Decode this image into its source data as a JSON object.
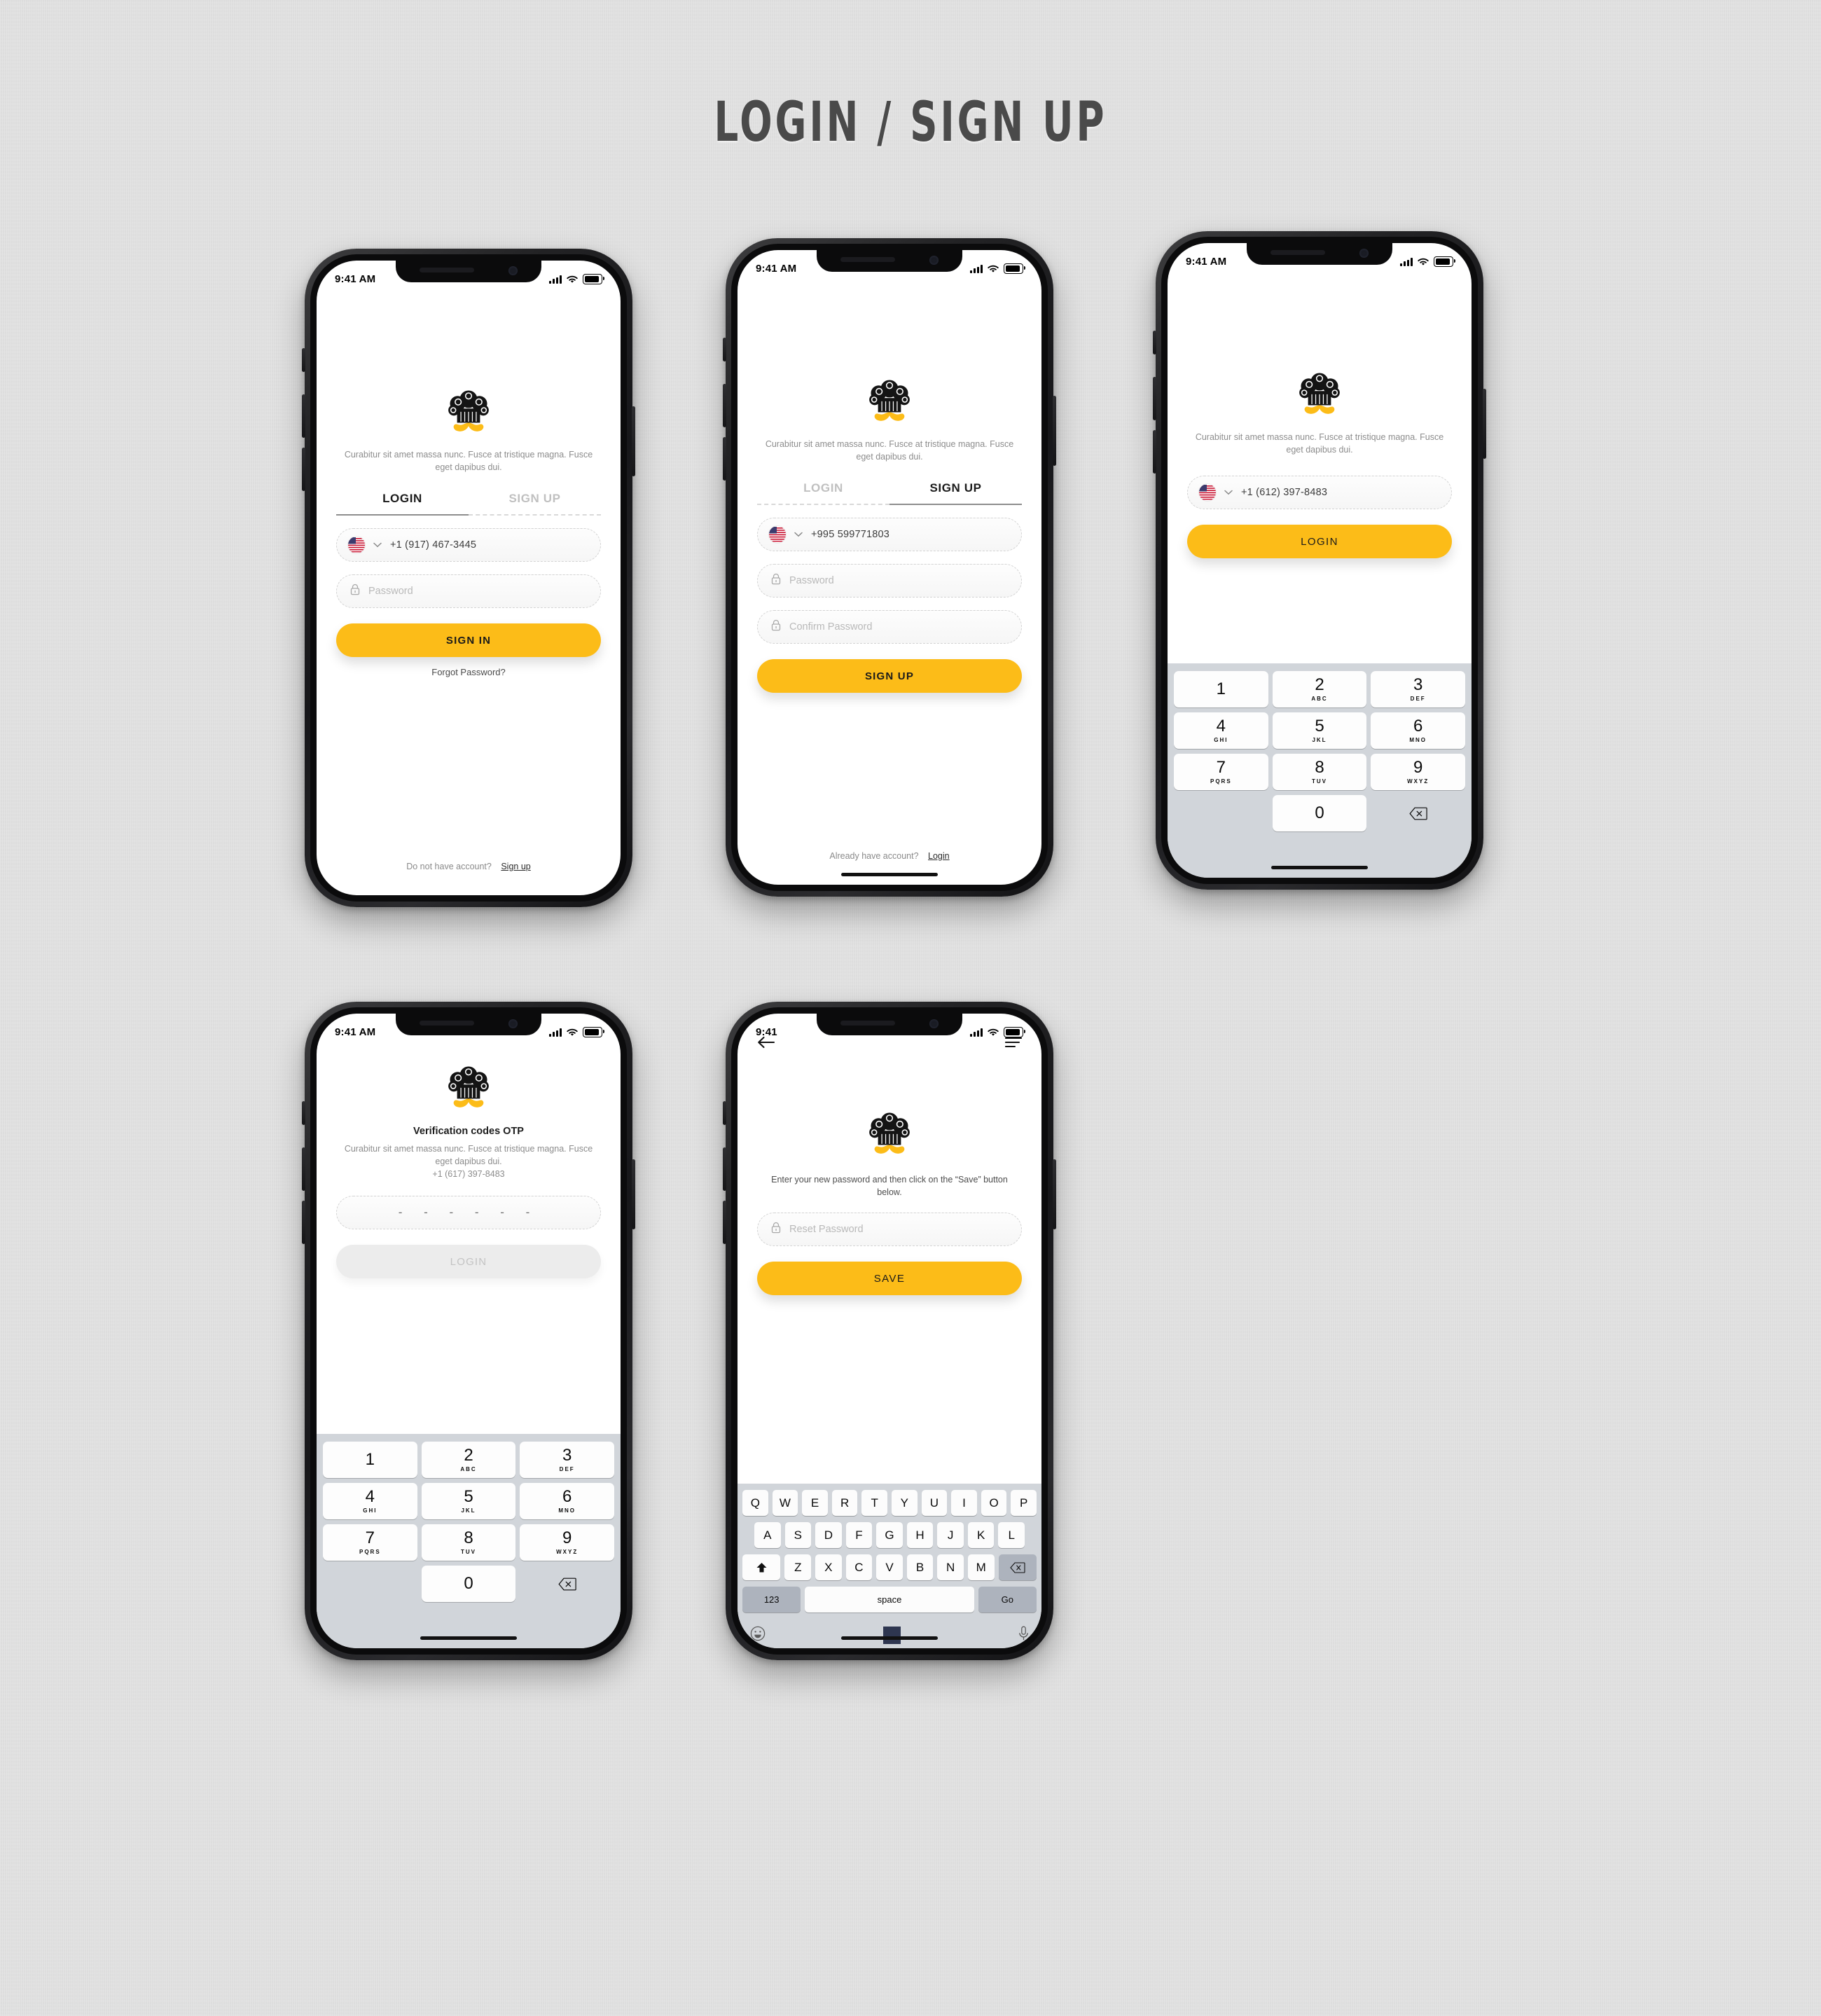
{
  "page": {
    "title": "LOGIN / SIGN UP",
    "background_color": "#dedede",
    "accent_color": "#fcbc18",
    "text_color": "#1b1b1b",
    "muted_color": "#8c8c8c"
  },
  "brand": {
    "logo_name": "chef-hat-mustache-logo",
    "hat_color": "#141414",
    "mustache_color": "#fcbc18"
  },
  "status_bar": {
    "time_long": "9:41 AM",
    "time_short": "9:41",
    "signal_icon": "cellular-bars-icon",
    "wifi_icon": "wifi-icon",
    "battery_icon": "battery-full-icon"
  },
  "common": {
    "tagline": "Curabitur sit amet massa nunc. Fusce at tristique magna. Fusce eget dapibus dui.",
    "tab_login": "LOGIN",
    "tab_signup": "SIGN UP",
    "password_placeholder": "Password",
    "confirm_password_placeholder": "Confirm Password",
    "flag_icon": "us-flag-icon",
    "chevron_icon": "chevron-down-icon",
    "lock_icon": "lock-icon"
  },
  "screens": [
    {
      "id": "login",
      "name": "Login",
      "active_tab": "LOGIN",
      "phone_value": "+1 (917) 467-3445",
      "primary_button": "SIGN IN",
      "link_text": "Forgot Password?",
      "footer_prompt": "Do not have account?",
      "footer_link": "Sign up",
      "home_indicator": false
    },
    {
      "id": "signup",
      "name": "Sign Up",
      "active_tab": "SIGN UP",
      "phone_value": "+995 599771803",
      "primary_button": "SIGN UP",
      "footer_prompt": "Already have account?",
      "footer_link": "Login",
      "home_indicator": true
    },
    {
      "id": "login-keypad",
      "name": "Login with numeric keypad",
      "phone_value": "+1 (612) 397-8483",
      "primary_button": "LOGIN",
      "home_indicator": true
    },
    {
      "id": "otp",
      "name": "Verification codes OTP",
      "heading": "Verification codes OTP",
      "description": "Curabitur sit amet massa nunc. Fusce at tristique magna. Fusce eget dapibus dui.",
      "target_phone": "+1 (617) 397-8483",
      "otp_placeholder": "-  -  -  -  -  -",
      "primary_button": "LOGIN",
      "primary_button_disabled": true,
      "home_indicator": true
    },
    {
      "id": "reset-password",
      "name": "Reset Password",
      "back_icon": "arrow-left-icon",
      "menu_icon": "hamburger-menu-icon",
      "description": "Enter your new password and then click on the “Save” button below.",
      "field_placeholder": "Reset Password",
      "primary_button": "SAVE",
      "home_indicator": true
    }
  ],
  "numeric_keypad": {
    "keys": [
      {
        "num": "1",
        "sub": ""
      },
      {
        "num": "2",
        "sub": "ABC"
      },
      {
        "num": "3",
        "sub": "DEF"
      },
      {
        "num": "4",
        "sub": "GHI"
      },
      {
        "num": "5",
        "sub": "JKL"
      },
      {
        "num": "6",
        "sub": "MNO"
      },
      {
        "num": "7",
        "sub": "PQRS"
      },
      {
        "num": "8",
        "sub": "TUV"
      },
      {
        "num": "9",
        "sub": "WXYZ"
      },
      {
        "num": "0",
        "sub": ""
      }
    ],
    "delete_icon": "backspace-icon"
  },
  "qwerty_keyboard": {
    "row1": [
      "Q",
      "W",
      "E",
      "R",
      "T",
      "Y",
      "U",
      "I",
      "O",
      "P"
    ],
    "row2": [
      "A",
      "S",
      "D",
      "F",
      "G",
      "H",
      "J",
      "K",
      "L"
    ],
    "row3": [
      "Z",
      "X",
      "C",
      "V",
      "B",
      "N",
      "M"
    ],
    "shift_icon": "shift-up-icon",
    "backspace_icon": "backspace-icon",
    "numeric_key": "123",
    "space_key": "space",
    "return_key": "Go",
    "emoji_icon": "emoji-smile-icon",
    "mic_icon": "microphone-icon"
  }
}
